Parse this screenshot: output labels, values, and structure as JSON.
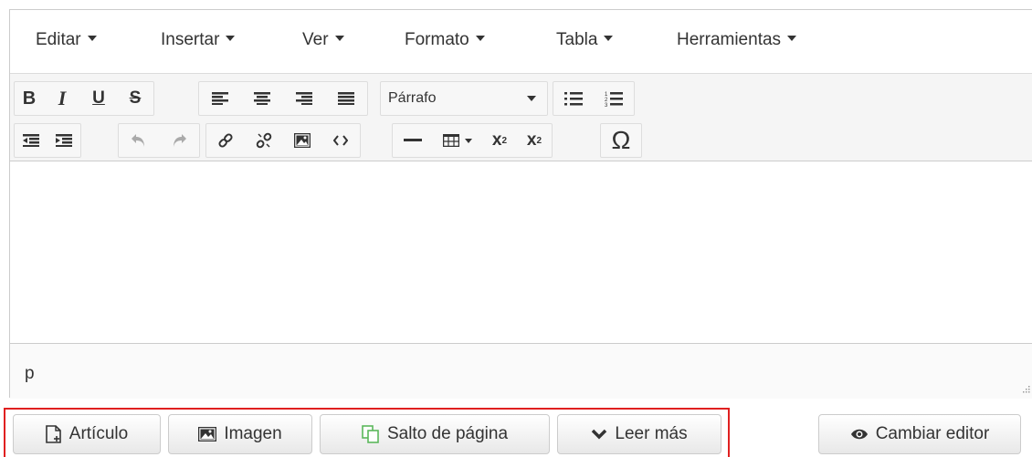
{
  "menubar": {
    "items": [
      {
        "label": "Editar"
      },
      {
        "label": "Insertar"
      },
      {
        "label": "Ver"
      },
      {
        "label": "Formato"
      },
      {
        "label": "Tabla"
      },
      {
        "label": "Herramientas"
      }
    ]
  },
  "toolbar": {
    "bold": "B",
    "italic": "I",
    "underline": "U",
    "strikethrough": "S",
    "format_select": "Párrafo",
    "subscript": "x",
    "superscript": "x",
    "special_char": "Ω"
  },
  "statusbar": {
    "path": "p"
  },
  "buttons": {
    "article": "Artículo",
    "image": "Imagen",
    "pagebreak": "Salto de página",
    "readmore": "Leer más",
    "toggle_editor": "Cambiar editor"
  },
  "colors": {
    "highlight": "#e02020",
    "pagebreak_icon": "#5cb85c"
  }
}
